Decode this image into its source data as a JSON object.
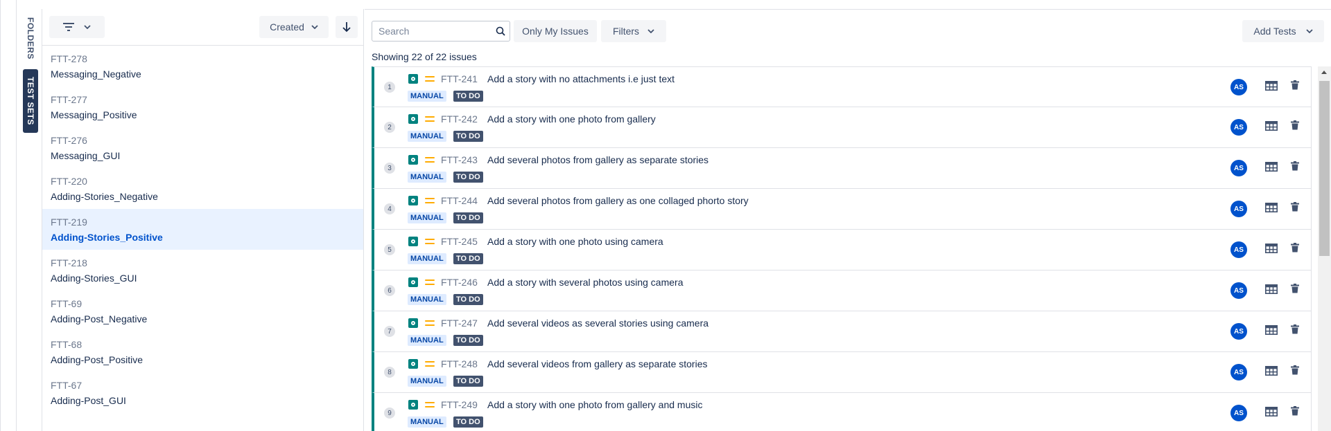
{
  "side_tabs": {
    "folders": "FOLDERS",
    "test_sets": "TEST SETS"
  },
  "sidebar": {
    "sort_label": "Created",
    "items": [
      {
        "key": "FTT-278",
        "name": "Messaging_Negative"
      },
      {
        "key": "FTT-277",
        "name": "Messaging_Positive"
      },
      {
        "key": "FTT-276",
        "name": "Messaging_GUI"
      },
      {
        "key": "FTT-220",
        "name": "Adding-Stories_Negative"
      },
      {
        "key": "FTT-219",
        "name": "Adding-Stories_Positive"
      },
      {
        "key": "FTT-218",
        "name": "Adding-Stories_GUI"
      },
      {
        "key": "FTT-69",
        "name": "Adding-Post_Negative"
      },
      {
        "key": "FTT-68",
        "name": "Adding-Post_Positive"
      },
      {
        "key": "FTT-67",
        "name": "Adding-Post_GUI"
      }
    ],
    "selected_index": 4
  },
  "toolbar": {
    "search_placeholder": "Search",
    "only_mine_label": "Only My Issues",
    "filters_label": "Filters",
    "add_tests_label": "Add Tests"
  },
  "showing_text": "Showing 22 of 22 issues",
  "issues": [
    {
      "num": "1",
      "key": "FTT-241",
      "summary": "Add a story with no attachments i.e just text",
      "type": "MANUAL",
      "status": "TO DO",
      "assignee": "AS"
    },
    {
      "num": "2",
      "key": "FTT-242",
      "summary": "Add a story with one photo from gallery",
      "type": "MANUAL",
      "status": "TO DO",
      "assignee": "AS"
    },
    {
      "num": "3",
      "key": "FTT-243",
      "summary": "Add several photos from gallery as separate stories",
      "type": "MANUAL",
      "status": "TO DO",
      "assignee": "AS"
    },
    {
      "num": "4",
      "key": "FTT-244",
      "summary": "Add several photos from gallery as one collaged phorto story",
      "type": "MANUAL",
      "status": "TO DO",
      "assignee": "AS"
    },
    {
      "num": "5",
      "key": "FTT-245",
      "summary": "Add a story with one photo using camera",
      "type": "MANUAL",
      "status": "TO DO",
      "assignee": "AS"
    },
    {
      "num": "6",
      "key": "FTT-246",
      "summary": "Add a story with several photos using camera",
      "type": "MANUAL",
      "status": "TO DO",
      "assignee": "AS"
    },
    {
      "num": "7",
      "key": "FTT-247",
      "summary": "Add several videos as several stories using camera",
      "type": "MANUAL",
      "status": "TO DO",
      "assignee": "AS"
    },
    {
      "num": "8",
      "key": "FTT-248",
      "summary": "Add several videos from gallery as separate stories",
      "type": "MANUAL",
      "status": "TO DO",
      "assignee": "AS"
    },
    {
      "num": "9",
      "key": "FTT-249",
      "summary": "Add a story with one photo from gallery and music",
      "type": "MANUAL",
      "status": "TO DO",
      "assignee": "AS"
    }
  ],
  "colors": {
    "accent_teal": "#00827f",
    "selected_bg": "#e9f2ff",
    "priority_medium": "#ffab00",
    "avatar_blue": "#0052cc",
    "status_dark": "#42526e"
  },
  "icons": {
    "filter": "filter-lines-icon",
    "chevron": "chevron-down-icon",
    "sort_direction": "arrow-down-icon",
    "search": "search-icon",
    "test_type": "test-issue-type-icon",
    "priority": "priority-medium-icon",
    "steps": "table-grid-icon",
    "remove": "trash-icon"
  }
}
